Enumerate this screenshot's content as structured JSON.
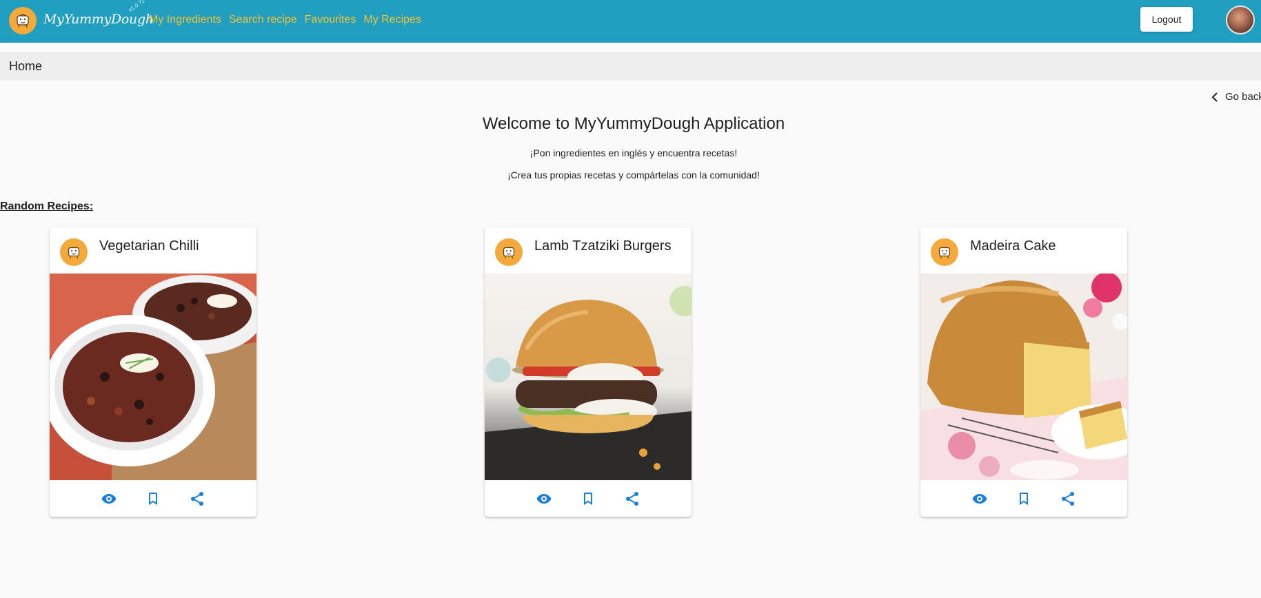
{
  "header": {
    "brand": "MyYummyDough",
    "version": "v1.0.72",
    "nav": [
      "My Ingredients",
      "Search recipe",
      "Favourites",
      "My Recipes"
    ],
    "logout_label": "Logout",
    "colors": {
      "bar": "#219fc1",
      "nav_link": "#f2c032",
      "logo_bg": "#f4a93b"
    }
  },
  "breadcrumb": {
    "current": "Home"
  },
  "go_back_label": "Go back",
  "welcome": {
    "title": "Welcome to MyYummyDough Application",
    "line1": "¡Pon ingredientes en inglés y encuentra recetas!",
    "line2": "¡Crea tus propias recetas y compártelas con la comunidad!"
  },
  "random_label": "Random Recipes:",
  "recipes": [
    {
      "title": "Vegetarian Chilli",
      "image": "bowls of vegetarian chilli"
    },
    {
      "title": "Lamb Tzatziki Burgers",
      "image": "lamb burger with tzatziki"
    },
    {
      "title": "Madeira Cake",
      "image": "loaf of madeira cake"
    }
  ],
  "card_actions": [
    "view-icon",
    "bookmark-icon",
    "share-icon"
  ],
  "action_color": "#1a7ee0"
}
